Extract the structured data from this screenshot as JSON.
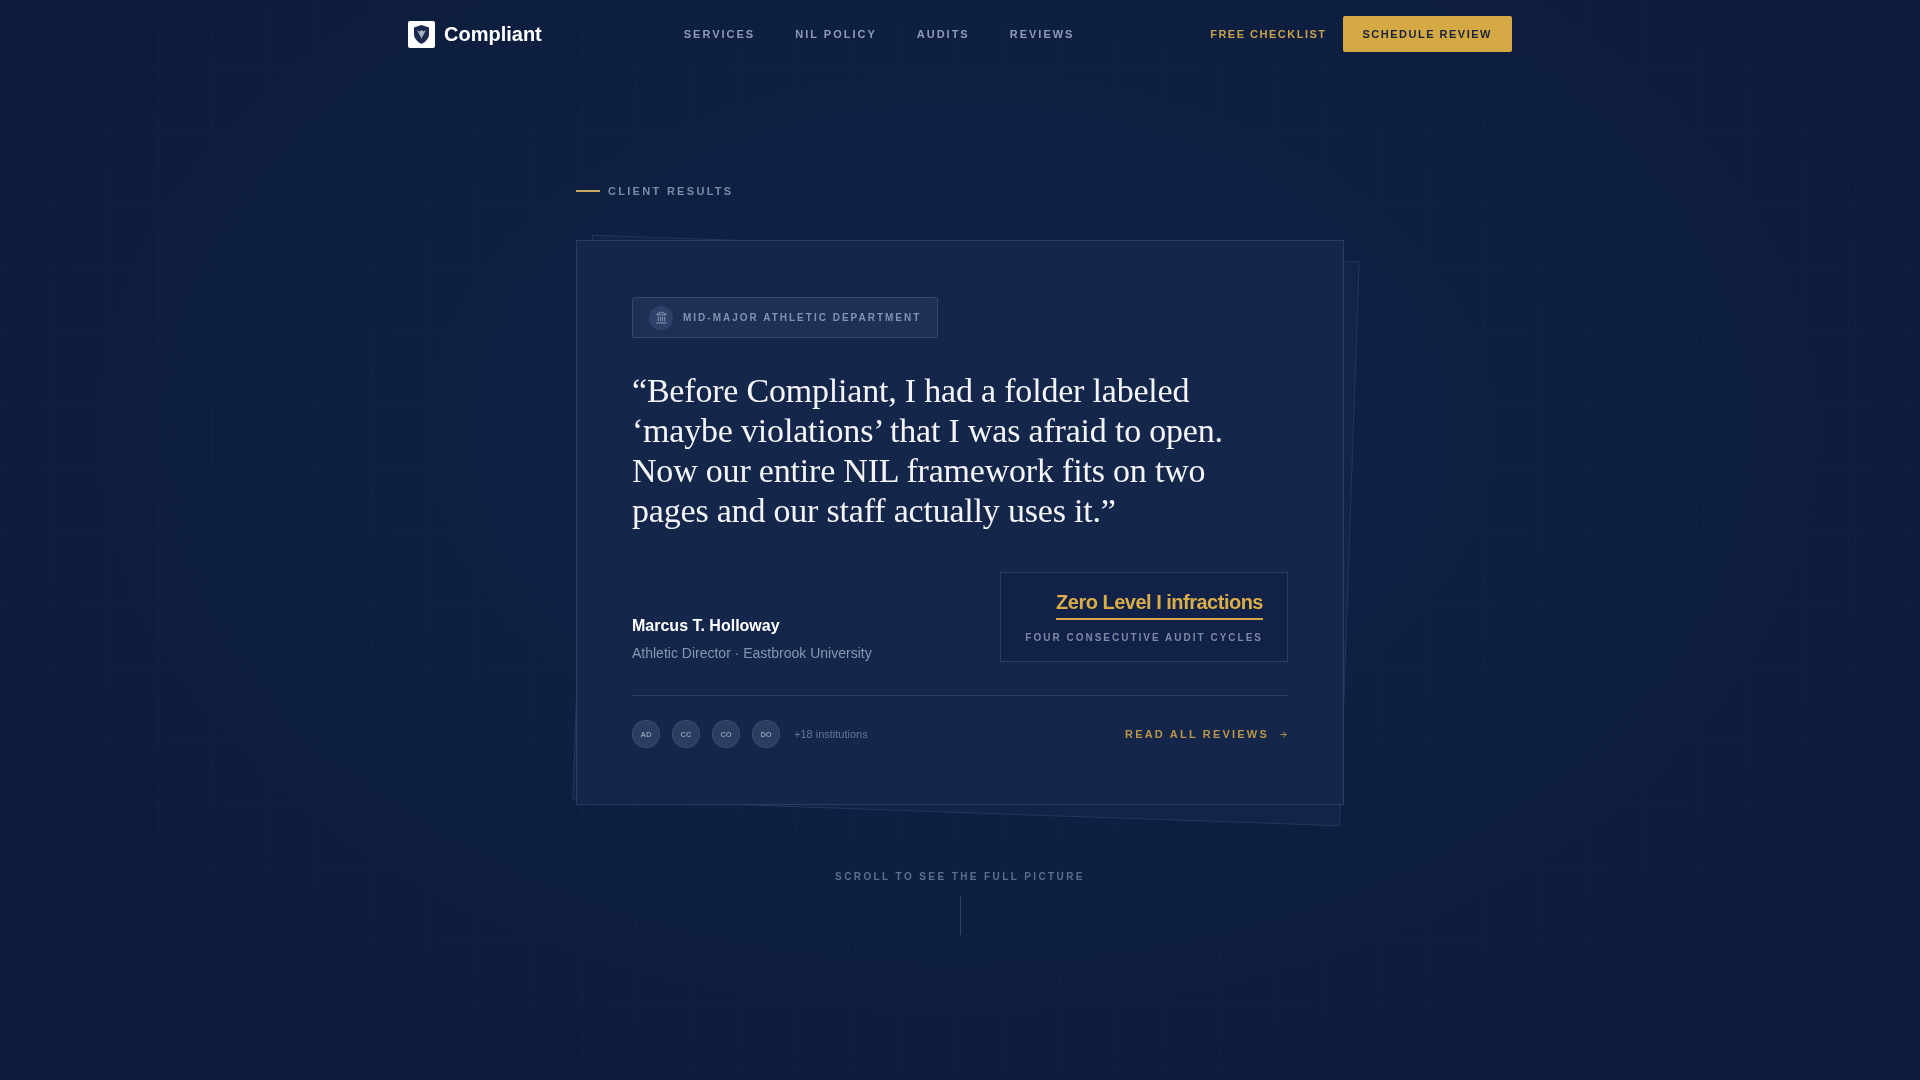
{
  "nav": {
    "brand": "Compliant",
    "links": [
      "SERVICES",
      "NIL POLICY",
      "AUDITS",
      "REVIEWS"
    ],
    "secondary_link": "FREE CHECKLIST",
    "cta": "SCHEDULE REVIEW"
  },
  "section": {
    "eyebrow": "CLIENT RESULTS"
  },
  "testimonial": {
    "tag": "MID-MAJOR ATHLETIC DEPARTMENT",
    "quote": "“Before Compliant, I had a folder labeled ‘maybe violations’ that I was afraid to open. Now our entire NIL framework fits on two pages and our staff actually uses it.”",
    "author": {
      "name": "Marcus T. Holloway",
      "role": "Athletic Director · Eastbrook University"
    },
    "stat": {
      "value": "Zero Level I infractions",
      "caption": "FOUR CONSECUTIVE AUDIT CYCLES"
    },
    "institutions": [
      "AD",
      "CC",
      "CO",
      "DO"
    ],
    "more_institutions": "+18 institutions",
    "link": "READ ALL REVIEWS"
  },
  "scroll_hint": "SCROLL TO SEE THE FULL PICTURE"
}
